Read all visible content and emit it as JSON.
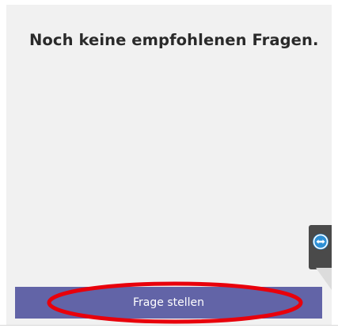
{
  "panel": {
    "empty_message": "Noch keine empfohlenen Fragen."
  },
  "side_tab": {
    "icon": "remote-support-icon",
    "icon_color": "#2d8fd5"
  },
  "actions": {
    "ask_question_label": "Frage stellen"
  },
  "annotation": {
    "color": "#e8000b"
  },
  "colors": {
    "panel_background": "#f1f1f1",
    "button_background": "#6264a7",
    "button_text": "#ffffff"
  }
}
